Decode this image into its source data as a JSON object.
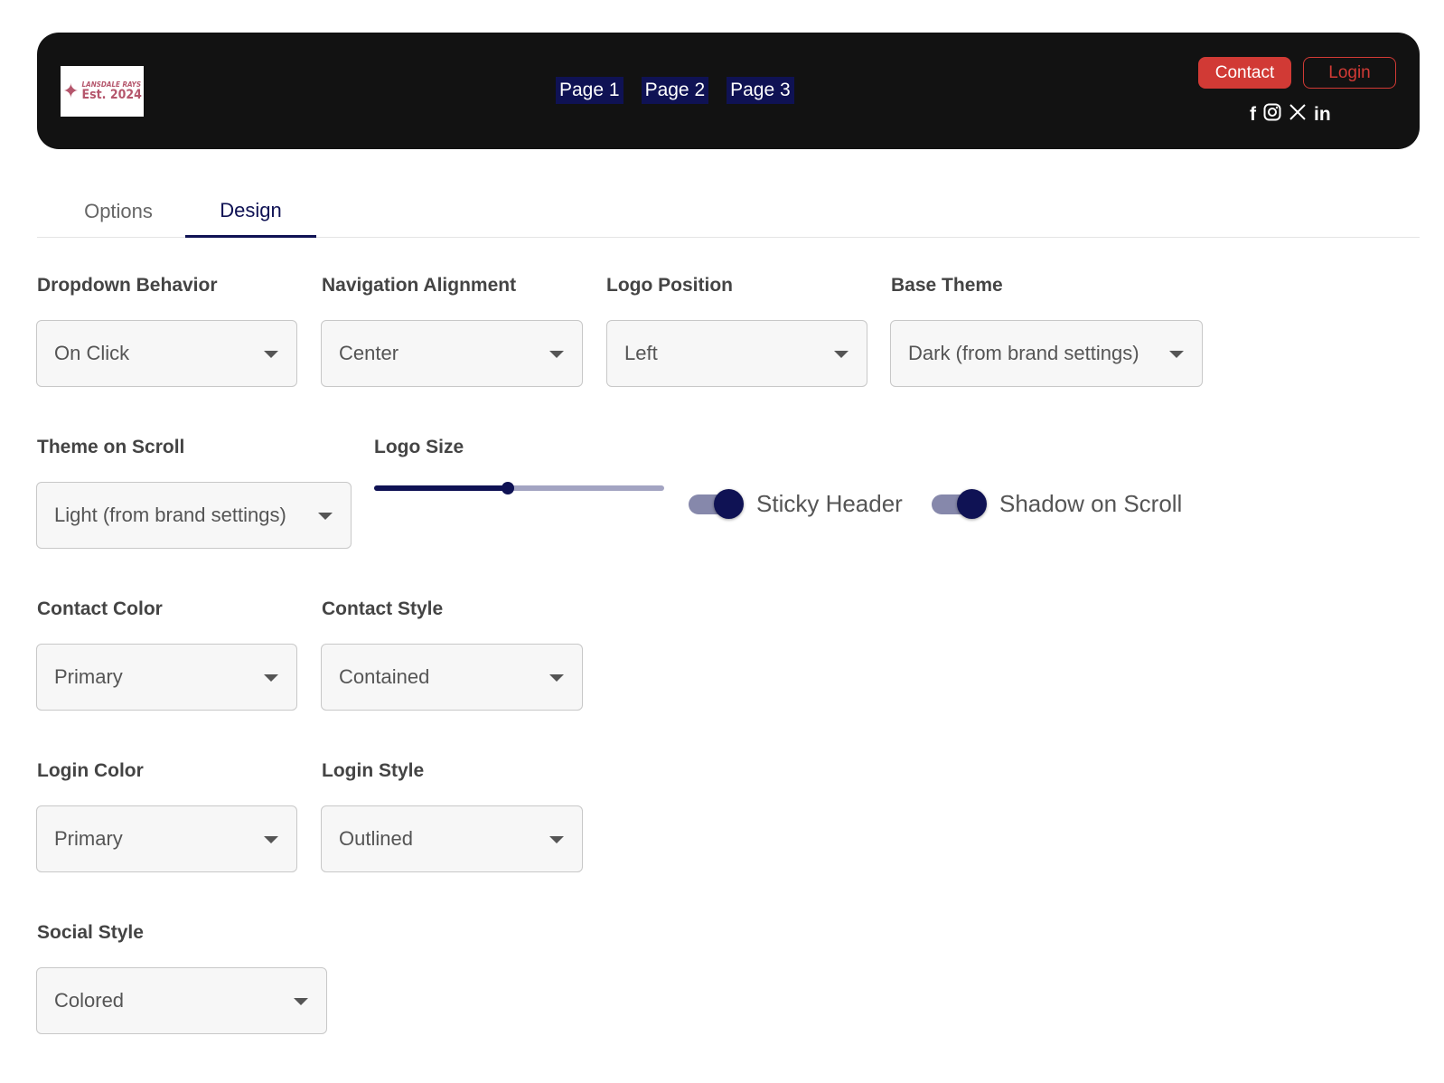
{
  "header": {
    "logo": {
      "line1": "LANSDALE RAYS",
      "line2": "Est. 2024"
    },
    "nav": [
      "Page 1",
      "Page 2",
      "Page 3"
    ],
    "contact_label": "Contact",
    "login_label": "Login",
    "social_icons": [
      "facebook-icon",
      "instagram-icon",
      "x-icon",
      "linkedin-icon"
    ],
    "accent_color": "#d13a35",
    "nav_bg_color": "#0f1254"
  },
  "tabs": [
    {
      "label": "Options",
      "active": false
    },
    {
      "label": "Design",
      "active": true
    }
  ],
  "fields": {
    "dropdown_behavior": {
      "label": "Dropdown Behavior",
      "value": "On Click"
    },
    "navigation_alignment": {
      "label": "Navigation Alignment",
      "value": "Center"
    },
    "logo_position": {
      "label": "Logo Position",
      "value": "Left"
    },
    "base_theme": {
      "label": "Base Theme",
      "value": "Dark (from brand settings)"
    },
    "theme_on_scroll": {
      "label": "Theme on Scroll",
      "value": "Light (from brand settings)"
    },
    "logo_size": {
      "label": "Logo Size",
      "value_percent": 46
    },
    "sticky_header": {
      "label": "Sticky Header",
      "on": true
    },
    "shadow_on_scroll": {
      "label": "Shadow on Scroll",
      "on": true
    },
    "contact_color": {
      "label": "Contact Color",
      "value": "Primary"
    },
    "contact_style": {
      "label": "Contact Style",
      "value": "Contained"
    },
    "login_color": {
      "label": "Login Color",
      "value": "Primary"
    },
    "login_style": {
      "label": "Login Style",
      "value": "Outlined"
    },
    "social_style": {
      "label": "Social Style",
      "value": "Colored"
    }
  }
}
